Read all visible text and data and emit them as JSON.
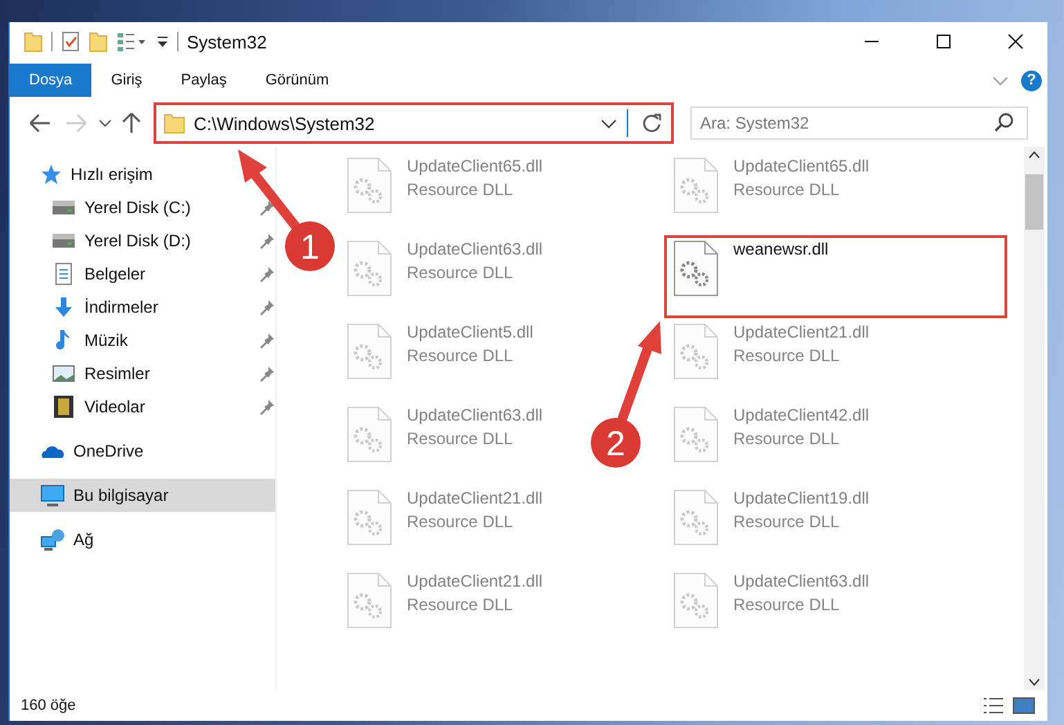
{
  "window": {
    "title": "System32"
  },
  "ribbon": {
    "tabs": [
      {
        "label": "Dosya",
        "selected": true
      },
      {
        "label": "Giriş",
        "selected": false
      },
      {
        "label": "Paylaş",
        "selected": false
      },
      {
        "label": "Görünüm",
        "selected": false
      }
    ],
    "help": "?"
  },
  "address_bar": {
    "path": "C:\\Windows\\System32",
    "forward_disabled": true,
    "highlighted": true
  },
  "search": {
    "placeholder": "Ara: System32"
  },
  "sidebar": {
    "items": [
      {
        "label": "Hızlı erişim",
        "kind": "star",
        "selected": false,
        "children": [
          {
            "label": "Yerel Disk (C:)",
            "kind": "drive",
            "selected": false,
            "pinned": true
          },
          {
            "label": "Yerel Disk (D:)",
            "kind": "drive",
            "selected": false,
            "pinned": true
          },
          {
            "label": "Belgeler",
            "kind": "document",
            "selected": false,
            "pinned": true
          },
          {
            "label": "İndirmeler",
            "kind": "download",
            "selected": false,
            "pinned": true
          },
          {
            "label": "Müzik",
            "kind": "music",
            "selected": false,
            "pinned": true
          },
          {
            "label": "Resimler",
            "kind": "image",
            "selected": false,
            "pinned": true
          },
          {
            "label": "Videolar",
            "kind": "video",
            "selected": false,
            "pinned": true
          }
        ]
      },
      {
        "label": "OneDrive",
        "kind": "cloud",
        "selected": false
      },
      {
        "label": "Bu bilgisayar",
        "kind": "computer",
        "selected": true
      },
      {
        "label": "Ağ",
        "kind": "network",
        "selected": false
      }
    ]
  },
  "files": [
    {
      "name": "UpdateClient65.dll",
      "type": "Resource DLL",
      "dimmed": true
    },
    {
      "name": "UpdateClient65.dll",
      "type": "Resource DLL",
      "dimmed": true
    },
    {
      "name": "UpdateClient63.dll",
      "type": "Resource DLL",
      "dimmed": true
    },
    {
      "name": "weanewsr.dll",
      "dimmed": false,
      "highlighted": true
    },
    {
      "name": "UpdateClient5.dll",
      "type": "Resource DLL",
      "dimmed": true
    },
    {
      "name": "UpdateClient21.dll",
      "type": "Resource DLL",
      "dimmed": true
    },
    {
      "name": "UpdateClient63.dll",
      "type": "Resource DLL",
      "dimmed": true
    },
    {
      "name": "UpdateClient42.dll",
      "type": "Resource DLL",
      "dimmed": true
    },
    {
      "name": "UpdateClient21.dll",
      "type": "Resource DLL",
      "dimmed": true
    },
    {
      "name": "UpdateClient19.dll",
      "type": "Resource DLL",
      "dimmed": true
    },
    {
      "name": "UpdateClient21.dll",
      "type": "Resource DLL",
      "dimmed": true
    },
    {
      "name": "UpdateClient63.dll",
      "type": "Resource DLL",
      "dimmed": true
    }
  ],
  "status_bar": {
    "count": "160 öğe"
  },
  "annotations": [
    {
      "number": "1"
    },
    {
      "number": "2"
    }
  ]
}
